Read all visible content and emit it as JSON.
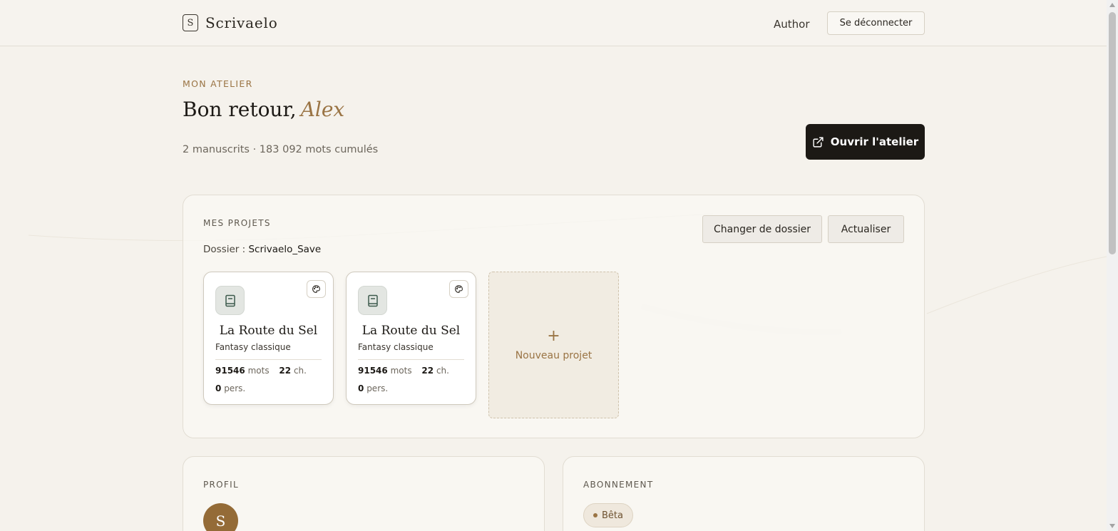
{
  "header": {
    "brand_mark": "S",
    "brand_name": "Scrivaelo",
    "author_link": "Author",
    "logout_label": "Se déconnecter"
  },
  "hero": {
    "eyebrow": "MON ATELIER",
    "greeting": "Bon retour,",
    "name": "Alex",
    "stats": "2 manuscrits · 183 092 mots cumulés",
    "open_button": "Ouvrir l'atelier"
  },
  "projects": {
    "title": "MES PROJETS",
    "folder_label": "Dossier :",
    "folder_value": "Scrivaelo_Save",
    "change_folder_label": "Changer de dossier",
    "refresh_label": "Actualiser",
    "items": [
      {
        "title": "La Route du Sel",
        "genre": "Fantasy classique",
        "words": "91546",
        "words_unit": "mots",
        "chapters": "22",
        "chapters_unit": "ch.",
        "characters": "0",
        "characters_unit": "pers."
      },
      {
        "title": "La Route du Sel",
        "genre": "Fantasy classique",
        "words": "91546",
        "words_unit": "mots",
        "chapters": "22",
        "chapters_unit": "ch.",
        "characters": "0",
        "characters_unit": "pers."
      }
    ],
    "new_project_plus": "+",
    "new_project_label": "Nouveau projet"
  },
  "profile": {
    "title": "PROFIL",
    "avatar_initial": "S"
  },
  "subscription": {
    "title": "ABONNEMENT",
    "badge": "Bêta"
  },
  "colors": {
    "background": "#f5f2ec",
    "accent": "#9a7444",
    "dark": "#1c1915"
  },
  "icons": {
    "logo": "brand-logo-icon",
    "external_link": "external-link-icon",
    "book": "book-icon",
    "palette": "palette-icon"
  }
}
